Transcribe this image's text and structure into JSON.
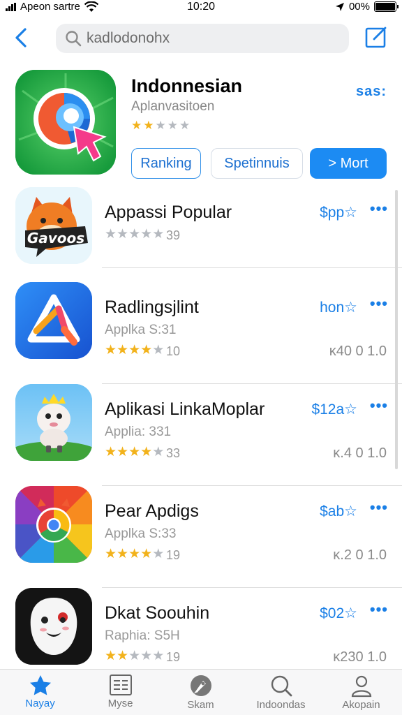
{
  "status_bar": {
    "carrier": "Apeon sartre",
    "time": "10:20",
    "battery": "00%"
  },
  "search": {
    "placeholder": "kadlodonohx"
  },
  "featured": {
    "title": "Indonnesian",
    "subtitle": "Aplanvasitoen",
    "stars_filled": 2,
    "stars_total": 5,
    "menu_label": "sas:",
    "buttons": [
      {
        "label": "Ranking"
      },
      {
        "label": "Spetinnuis"
      },
      {
        "label": "> Mort"
      }
    ]
  },
  "apps": [
    {
      "name": "Appassi Popular",
      "subtitle": "",
      "stars_filled": 0,
      "rating_count": "39",
      "price": "$pp",
      "size": "",
      "icon": "fox-badge-icon",
      "icon_text": "Gavoos"
    },
    {
      "name": "Radlingsjlint",
      "subtitle": "Applka S:31",
      "stars_filled": 4,
      "rating_count": "10",
      "price": "hon",
      "size": "ᴋ40 0 1.0",
      "icon": "triangle-arrow-icon"
    },
    {
      "name": "Aplikasi LinkaMoplar",
      "subtitle": "Applia: 331",
      "stars_filled": 4,
      "rating_count": "33",
      "price": "$12a",
      "size": "ᴋ.4 0 1.0",
      "icon": "cartoon-lamb-icon"
    },
    {
      "name": "Pear Apdigs",
      "subtitle": "Applka S:33",
      "stars_filled": 4,
      "rating_count": "19",
      "price": "$ab",
      "size": "ᴋ.2 0 1.0",
      "icon": "rainbow-browser-icon"
    },
    {
      "name": "Dkat Soouhin",
      "subtitle": "Raphia: S5H",
      "stars_filled": 2,
      "rating_count": "19",
      "price": "$02",
      "size": "ᴋ230 1.0",
      "icon": "white-mask-icon"
    }
  ],
  "tabs": [
    {
      "label": "Nayay",
      "icon": "star-icon",
      "active": true
    },
    {
      "label": "Myse",
      "icon": "list-icon",
      "active": false
    },
    {
      "label": "Skam",
      "icon": "rocket-icon",
      "active": false
    },
    {
      "label": "Indoondas",
      "icon": "search-icon",
      "active": false
    },
    {
      "label": "Akopain",
      "icon": "person-icon",
      "active": false
    }
  ],
  "colors": {
    "accent": "#1a7fe6",
    "star": "#f2b21b",
    "button_primary": "#1c8bf3"
  }
}
